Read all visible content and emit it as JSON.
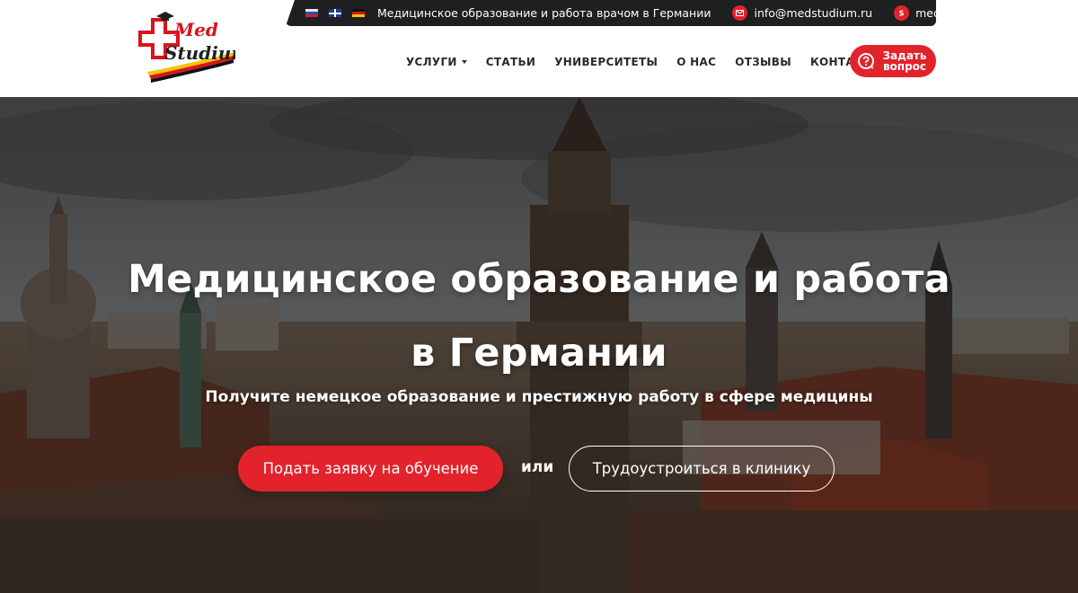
{
  "brand": {
    "logo_top": "Med",
    "logo_bottom": "Studium"
  },
  "topbar": {
    "languages": [
      "ru",
      "en",
      "de"
    ],
    "tagline": "Медицинское образование и работа врачом в Германии",
    "email": "info@medstudium.ru",
    "skype": "medstudium",
    "email_icon": "mail-icon",
    "skype_icon": "skype-icon"
  },
  "nav": {
    "items": [
      {
        "label": "УСЛУГИ",
        "has_dropdown": true
      },
      {
        "label": "СТАТЬИ"
      },
      {
        "label": "УНИВЕРСИТЕТЫ"
      },
      {
        "label": "О НАС"
      },
      {
        "label": "ОТЗЫВЫ"
      },
      {
        "label": "КОНТАКТЫ"
      }
    ],
    "ask_button": "Задать вопрос"
  },
  "hero": {
    "title_line1": "Медицинское образование и работа",
    "title_line2": "в Германии",
    "subtitle": "Получите немецкое образование и престижную работу в сфере медицины",
    "primary_button": "Подать заявку на обучение",
    "or_text": "или",
    "secondary_button": "Трудоустроиться в клинику"
  },
  "colors": {
    "accent": "#e3232c",
    "topbar_bg": "#1e1f21",
    "nav_text": "#2a2a2a"
  }
}
